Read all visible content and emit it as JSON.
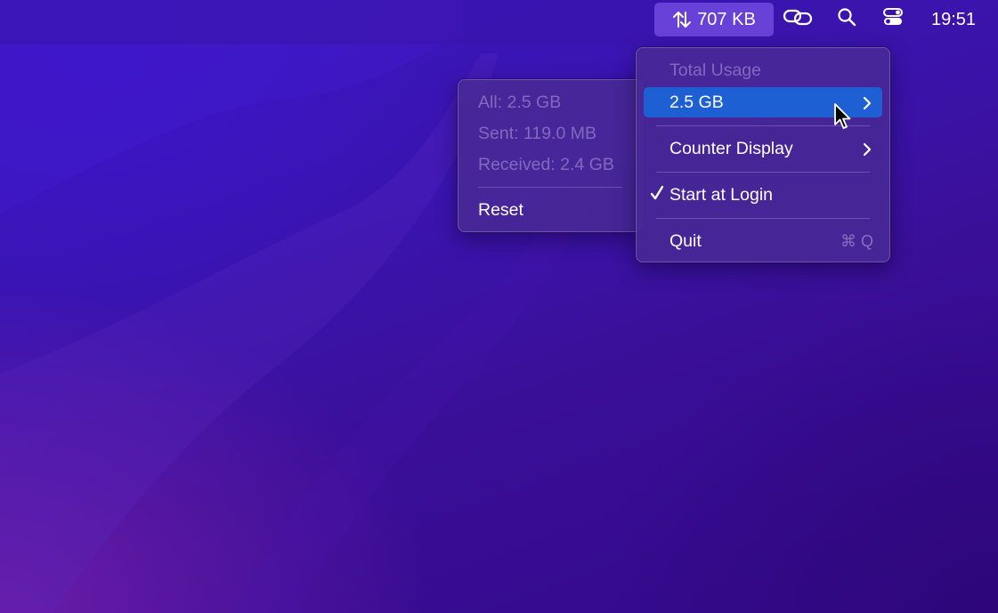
{
  "menubar": {
    "network_icon": "arrow-up-down-icon",
    "network_value": "707 KB",
    "link_icon": "link-icon",
    "search_icon": "search-icon",
    "control_center_icon": "control-center-icon",
    "clock": "19:51"
  },
  "main_menu": {
    "header": "Total Usage",
    "total_item": "2.5 GB",
    "counter_display": "Counter Display",
    "start_at_login": "Start at Login",
    "start_at_login_checked": true,
    "quit": "Quit",
    "quit_shortcut": "⌘ Q"
  },
  "usage_submenu": {
    "all": "All: 2.5 GB",
    "sent": "Sent: 119.0 MB",
    "received": "Received: 2.4 GB",
    "reset": "Reset"
  },
  "colors": {
    "highlight": "#1f5fd4",
    "menu_bg": "#482896",
    "wallpaper": "#3a0f98"
  }
}
